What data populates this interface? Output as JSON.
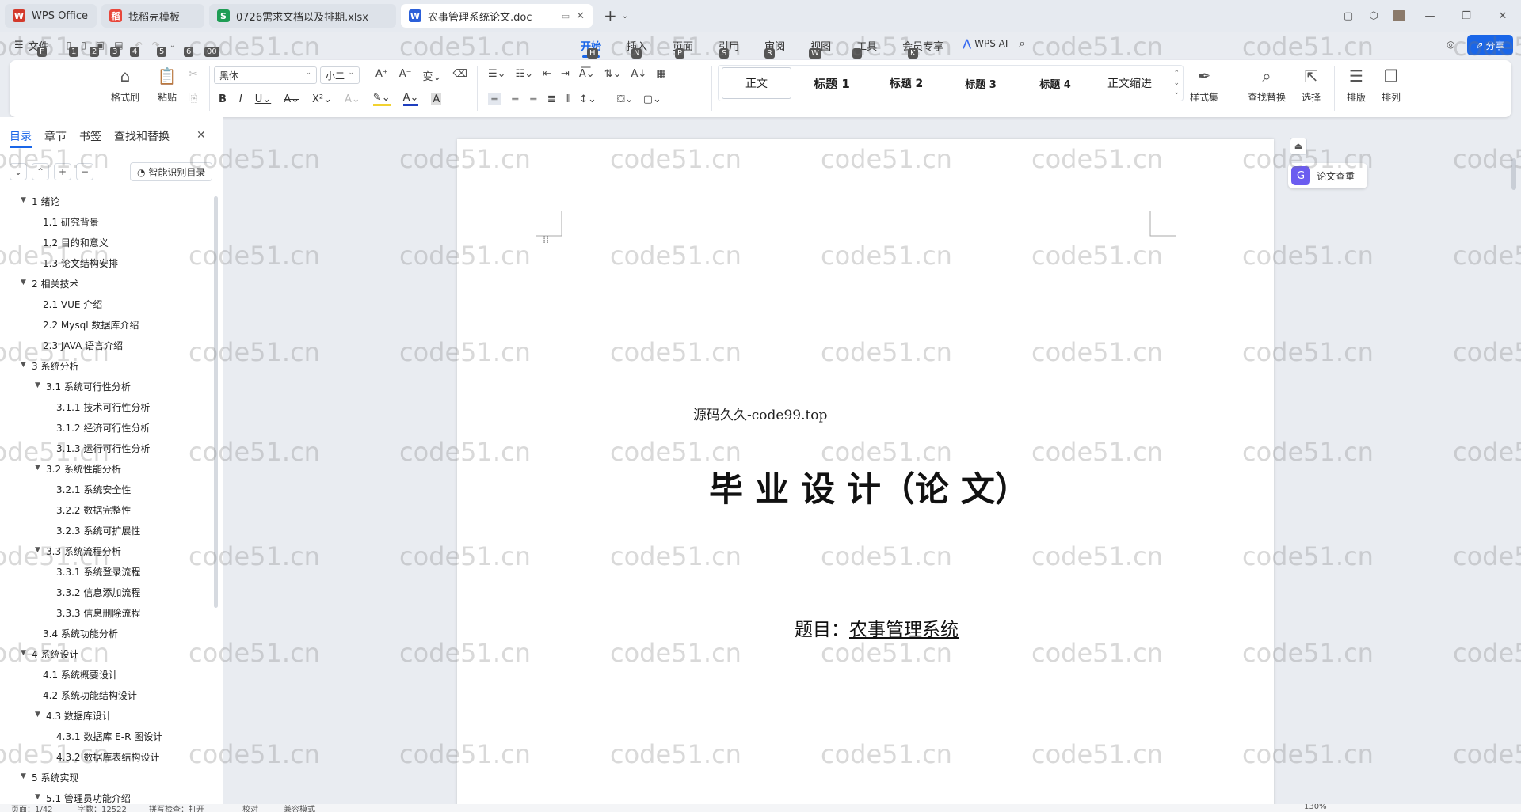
{
  "tabs": [
    {
      "label": "WPS Office",
      "icon": "wps-logo-icon",
      "color": "#d33a2c"
    },
    {
      "label": "找稻壳模板",
      "icon": "docer-logo-icon",
      "color": "#e8473b"
    },
    {
      "label": "0726需求文档以及排期.xlsx",
      "icon": "spreadsheet-logo-icon",
      "color": "#1f9d55"
    },
    {
      "label": "农事管理系统论文.doc",
      "icon": "writer-logo-icon",
      "color": "#2b5fd9"
    }
  ],
  "menu": {
    "file": "文件",
    "tabs": [
      "开始",
      "插入",
      "页面",
      "引用",
      "审阅",
      "视图",
      "工具",
      "会员专享"
    ],
    "keytips": [
      "H",
      "N",
      "P",
      "S",
      "R",
      "W",
      "L",
      "K"
    ],
    "wps_ai": "WPS AI",
    "share": "分享",
    "quick_keytips": [
      "F",
      "1",
      "2",
      "3",
      "4",
      "5",
      "6",
      "00"
    ]
  },
  "ribbon": {
    "format_painter": "格式刷",
    "paste": "粘贴",
    "font_name": "黑体",
    "font_size": "小二",
    "styles": [
      "正文",
      "标题 1",
      "标题 2",
      "标题 3",
      "标题 4",
      "正文缩进"
    ],
    "style_set": "样式集",
    "find_replace": "查找替换",
    "select": "选择",
    "layout": "排版",
    "arrange": "排列"
  },
  "sidebar": {
    "tabs": [
      "目录",
      "章节",
      "书签",
      "查找和替换"
    ],
    "smart_toc": "智能识别目录",
    "toc": [
      {
        "label": "1  绪论",
        "level": 1,
        "expanded": true
      },
      {
        "label": "1.1  研究背景",
        "level": 2
      },
      {
        "label": "1.2 目的和意义",
        "level": 2
      },
      {
        "label": "1.3  论文结构安排",
        "level": 2
      },
      {
        "label": "2  相关技术",
        "level": 1,
        "expanded": true
      },
      {
        "label": "2.1 VUE 介绍",
        "level": 2
      },
      {
        "label": "2.2 Mysql 数据库介绍",
        "level": 2
      },
      {
        "label": "2.3 JAVA 语言介绍",
        "level": 2
      },
      {
        "label": "3  系统分析",
        "level": 1,
        "expanded": true
      },
      {
        "label": "3.1 系统可行性分析",
        "level": 2,
        "expanded": true
      },
      {
        "label": "3.1.1  技术可行性分析",
        "level": 3
      },
      {
        "label": "3.1.2  经济可行性分析",
        "level": 3
      },
      {
        "label": "3.1.3  运行可行性分析",
        "level": 3
      },
      {
        "label": "3.2 系统性能分析",
        "level": 2,
        "expanded": true
      },
      {
        "label": "3.2.1  系统安全性",
        "level": 3
      },
      {
        "label": "3.2.2  数据完整性",
        "level": 3
      },
      {
        "label": "3.2.3 系统可扩展性",
        "level": 3
      },
      {
        "label": "3.3 系统流程分析",
        "level": 2,
        "expanded": true
      },
      {
        "label": "3.3.1 系统登录流程",
        "level": 3
      },
      {
        "label": "3.3.2 信息添加流程",
        "level": 3
      },
      {
        "label": "3.3.3 信息删除流程",
        "level": 3
      },
      {
        "label": "3.4 系统功能分析",
        "level": 2
      },
      {
        "label": "4  系统设计",
        "level": 1,
        "expanded": true
      },
      {
        "label": "4.1 系统概要设计",
        "level": 2
      },
      {
        "label": "4.2 系统功能结构设计",
        "level": 2
      },
      {
        "label": "4.3 数据库设计",
        "level": 2,
        "expanded": true
      },
      {
        "label": "4.3.1 数据库 E-R 图设计",
        "level": 3
      },
      {
        "label": "4.3.2  数据库表结构设计",
        "level": 3
      },
      {
        "label": "5  系统实现",
        "level": 1,
        "expanded": true
      },
      {
        "label": "5.1 管理员功能介绍",
        "level": 2,
        "expanded": true
      }
    ]
  },
  "document": {
    "source_line": "源码久久-code99.top",
    "main_title": "毕 业 设 计（论 文）",
    "subject_prefix": "题目：",
    "subject": "农事管理系统"
  },
  "right_panel": {
    "plagiarism_check": "论文查重"
  },
  "watermark": "code51.cn",
  "status": {
    "page": "页面：1/42",
    "words": "字数：12522",
    "spell": "拼写检查：打开",
    "proof": "校对",
    "compat": "兼容模式",
    "zoom": "130%"
  },
  "colors": {
    "accent": "#1a66e8",
    "page": "#ffffff",
    "background": "#e9ecf1"
  }
}
